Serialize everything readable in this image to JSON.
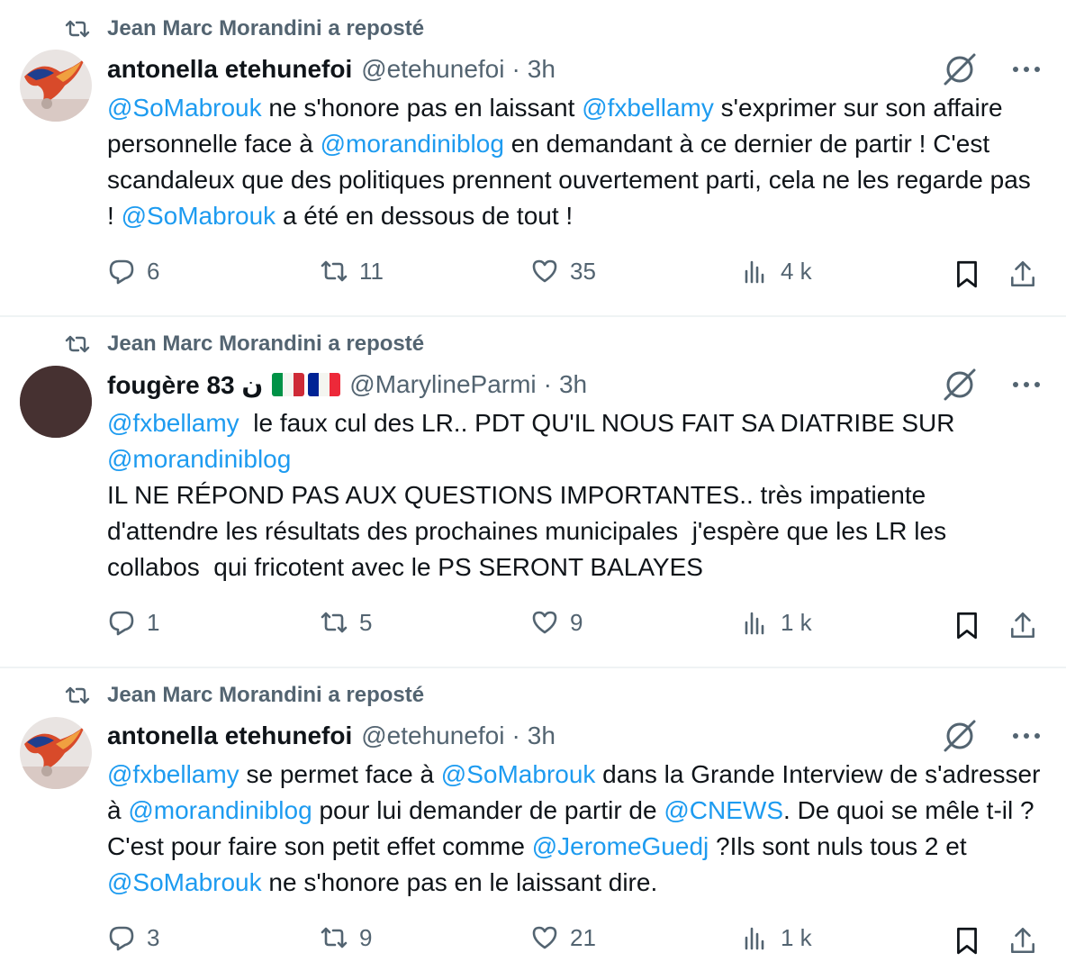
{
  "tweets": [
    {
      "repost_label": "Jean Marc Morandini a reposté",
      "name": "antonella etehunefoi",
      "handle": "@etehunefoi",
      "time": "3h",
      "body": [
        {
          "t": "@SoMabrouk",
          "m": true
        },
        {
          "t": " ne s'honore pas en laissant ",
          "m": false
        },
        {
          "t": "@fxbellamy",
          "m": true
        },
        {
          "t": " s'exprimer sur son affaire personnelle face à ",
          "m": false
        },
        {
          "t": "@morandiniblog",
          "m": true
        },
        {
          "t": " en demandant à ce dernier de partir ! C'est scandaleux que des politiques prennent ouvertement parti, cela ne les regarde pas ! ",
          "m": false
        },
        {
          "t": "@SoMabrouk",
          "m": true
        },
        {
          "t": " a été en dessous de tout !",
          "m": false
        }
      ],
      "replies": "6",
      "reposts": "11",
      "likes": "35",
      "views": "4 k"
    },
    {
      "repost_label": "Jean Marc Morandini a reposté",
      "name": "fougère 83 ن",
      "handle": "@MarylineParmi",
      "time": "3h",
      "body": [
        {
          "t": "@fxbellamy",
          "m": true
        },
        {
          "t": "  le faux cul des LR.. PDT QU'IL NOUS FAIT SA DIATRIBE SUR\n",
          "m": false
        },
        {
          "t": "@morandiniblog",
          "m": true
        },
        {
          "t": "\nIL NE RÉPOND PAS AUX QUESTIONS IMPORTANTES.. très impatiente d'attendre les résultats des prochaines municipales  j'espère que les LR les collabos  qui fricotent avec le PS SERONT BALAYES",
          "m": false
        }
      ],
      "replies": "1",
      "reposts": "5",
      "likes": "9",
      "views": "1 k"
    },
    {
      "repost_label": "Jean Marc Morandini a reposté",
      "name": "antonella etehunefoi",
      "handle": "@etehunefoi",
      "time": "3h",
      "body": [
        {
          "t": "@fxbellamy",
          "m": true
        },
        {
          "t": " se permet face à ",
          "m": false
        },
        {
          "t": "@SoMabrouk",
          "m": true
        },
        {
          "t": " dans la Grande Interview de s'adresser à ",
          "m": false
        },
        {
          "t": "@morandiniblog",
          "m": true
        },
        {
          "t": " pour lui demander de partir de ",
          "m": false
        },
        {
          "t": "@CNEWS",
          "m": true
        },
        {
          "t": ". De quoi se mêle t-il ?C'est pour faire son petit effet comme ",
          "m": false
        },
        {
          "t": "@JeromeGuedj",
          "m": true
        },
        {
          "t": " ?Ils sont nuls tous 2 et ",
          "m": false
        },
        {
          "t": "@SoMabrouk",
          "m": true
        },
        {
          "t": " ne s'honore pas en le laissant dire.",
          "m": false
        }
      ],
      "replies": "3",
      "reposts": "9",
      "likes": "21",
      "views": "1 k"
    }
  ],
  "colors": {
    "mention": "#1d9bf0",
    "secondary": "#536471",
    "text": "#0f1419",
    "divider": "#eff3f4"
  },
  "icons": [
    "repost-icon",
    "grok-icon",
    "more-icon",
    "reply-icon",
    "like-icon",
    "views-icon",
    "bookmark-icon",
    "share-icon"
  ]
}
